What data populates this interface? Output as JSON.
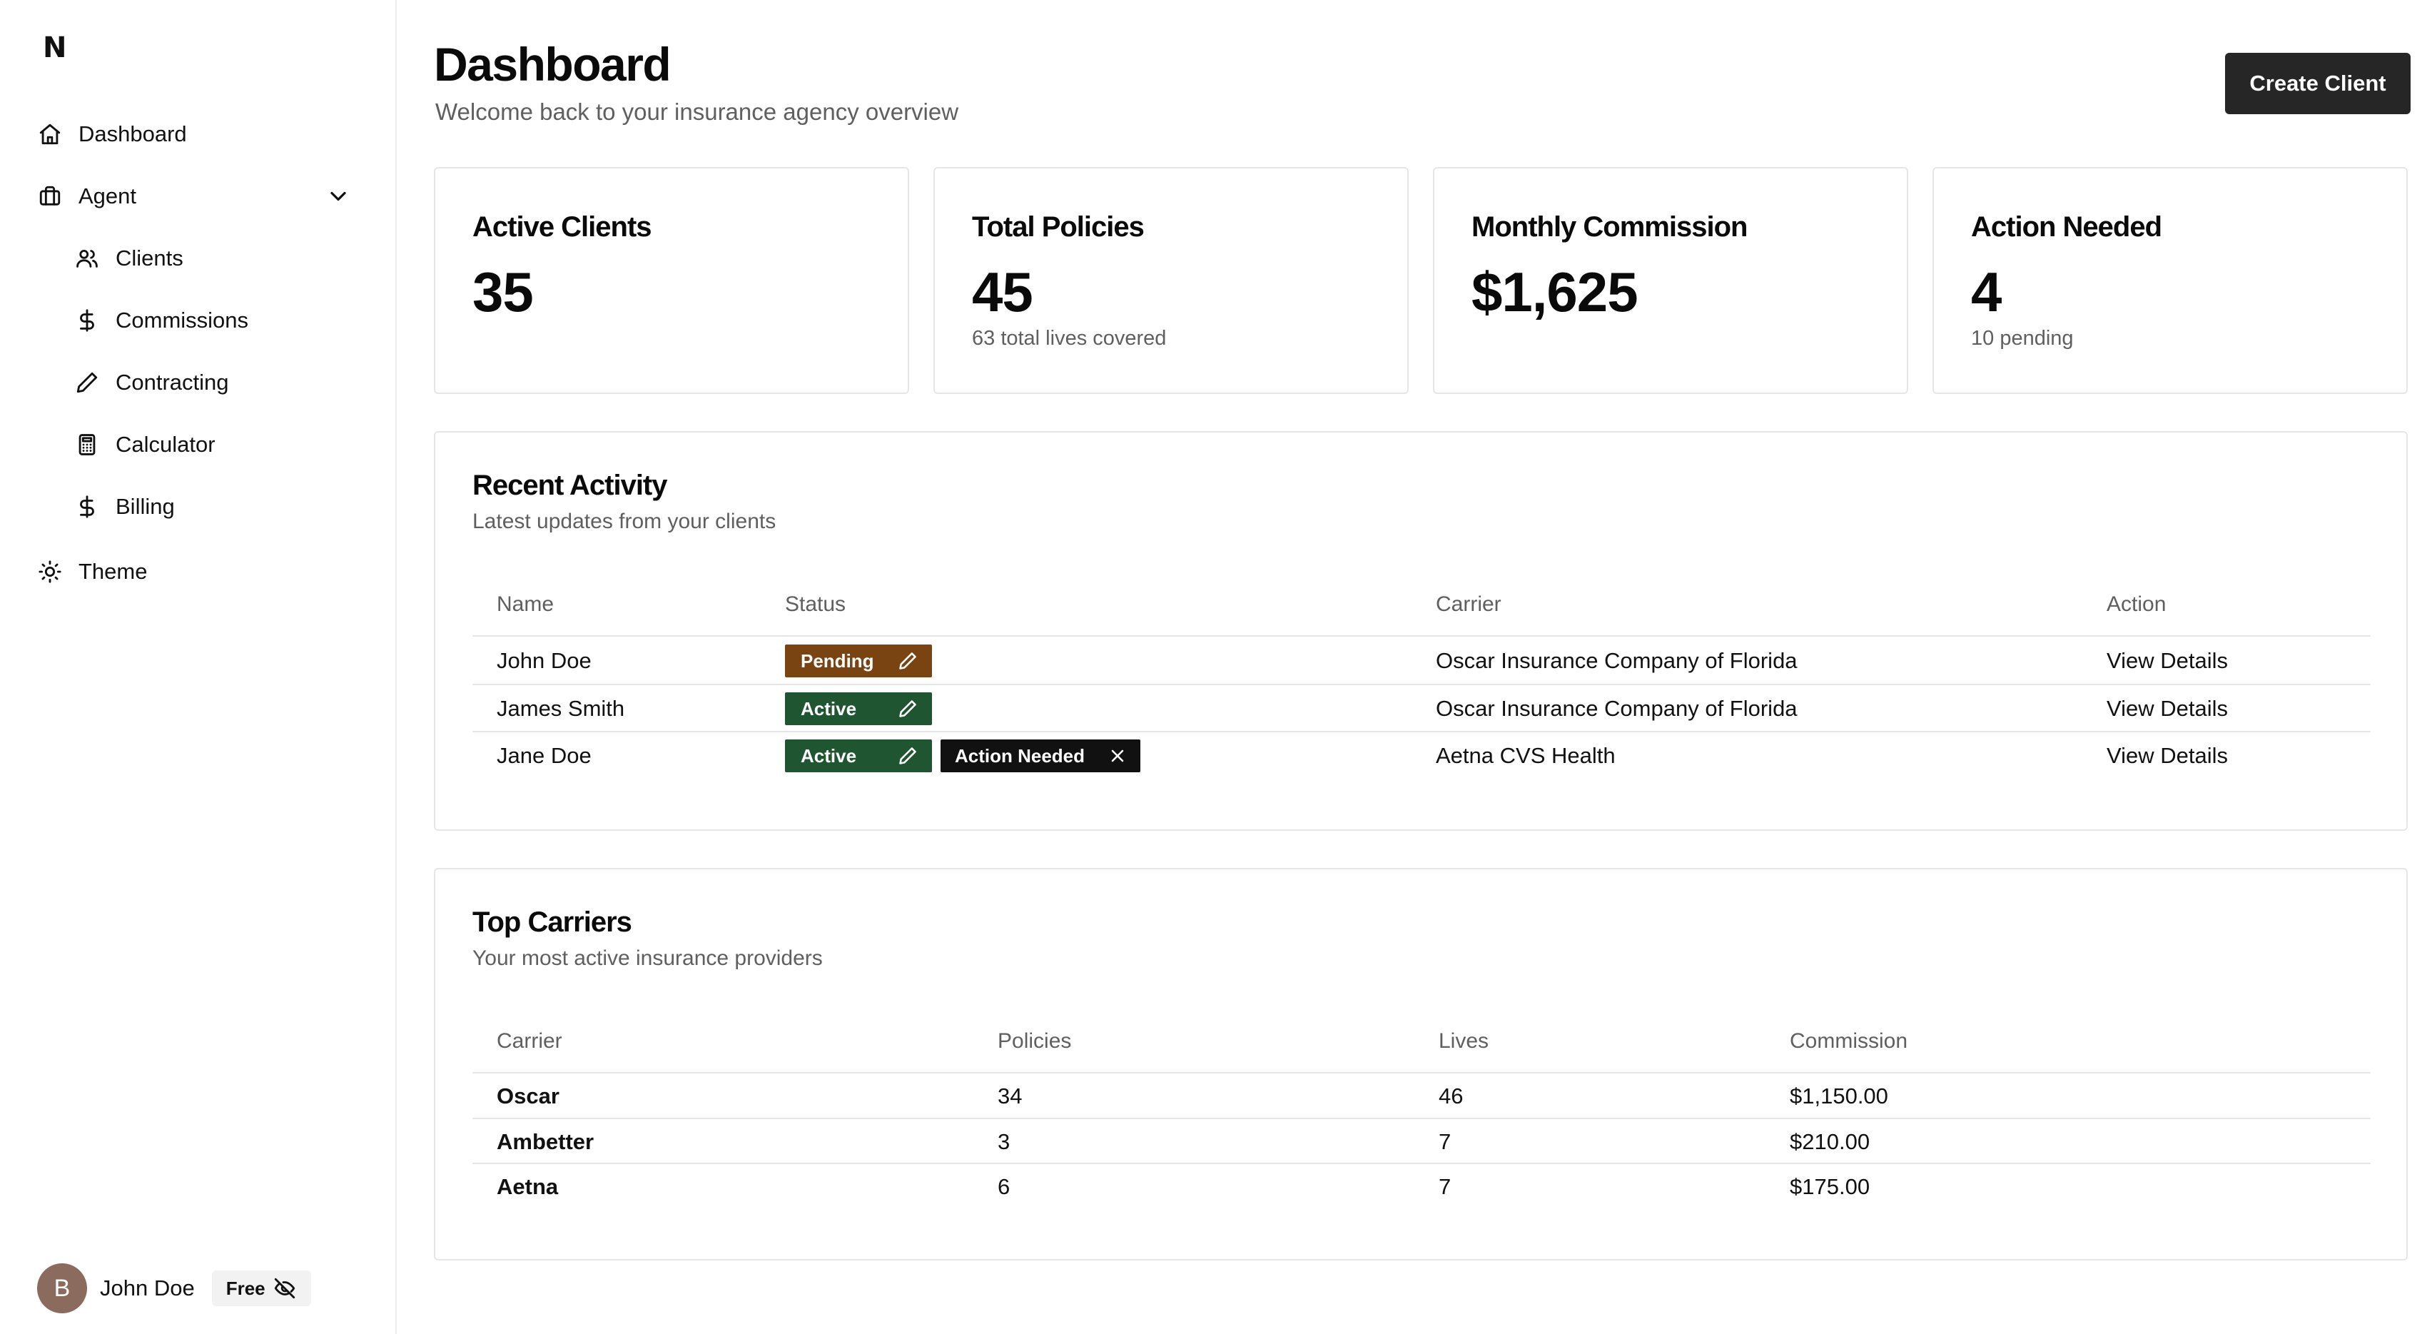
{
  "app": {
    "logo": "N"
  },
  "sidebar": {
    "items": [
      {
        "label": "Dashboard",
        "icon": "home-icon"
      },
      {
        "label": "Agent",
        "icon": "briefcase-icon"
      },
      {
        "label": "Clients",
        "icon": "users-icon"
      },
      {
        "label": "Commissions",
        "icon": "dollar-icon"
      },
      {
        "label": "Contracting",
        "icon": "pencil-icon"
      },
      {
        "label": "Calculator",
        "icon": "calculator-icon"
      },
      {
        "label": "Billing",
        "icon": "dollar-icon"
      },
      {
        "label": "Theme",
        "icon": "sun-icon"
      }
    ],
    "user": {
      "avatar_initial": "B",
      "name": "John Doe",
      "plan": "Free"
    }
  },
  "header": {
    "title": "Dashboard",
    "subtitle": "Welcome back to your insurance agency overview",
    "create_label": "Create Client"
  },
  "stats": [
    {
      "title": "Active Clients",
      "value": "35",
      "sub": ""
    },
    {
      "title": "Total Policies",
      "value": "45",
      "sub": "63 total lives covered"
    },
    {
      "title": "Monthly Commission",
      "value": "$1,625",
      "sub": ""
    },
    {
      "title": "Action Needed",
      "value": "4",
      "sub": "10 pending"
    }
  ],
  "recent_activity": {
    "title": "Recent Activity",
    "subtitle": "Latest updates from your clients",
    "columns": [
      "Name",
      "Status",
      "Carrier",
      "Action"
    ],
    "rows": [
      {
        "name": "John Doe",
        "status": "Pending",
        "extra_badge": "",
        "carrier": "Oscar Insurance Company of Florida",
        "action": "View Details"
      },
      {
        "name": "James Smith",
        "status": "Active",
        "extra_badge": "",
        "carrier": "Oscar Insurance Company of Florida",
        "action": "View Details"
      },
      {
        "name": "Jane Doe",
        "status": "Active",
        "extra_badge": "Action Needed",
        "carrier": "Aetna CVS Health",
        "action": "View Details"
      }
    ]
  },
  "top_carriers": {
    "title": "Top Carriers",
    "subtitle": "Your most active insurance providers",
    "columns": [
      "Carrier",
      "Policies",
      "Lives",
      "Commission"
    ],
    "rows": [
      {
        "carrier": "Oscar",
        "policies": "34",
        "lives": "46",
        "commission": "$1,150.00"
      },
      {
        "carrier": "Ambetter",
        "policies": "3",
        "lives": "7",
        "commission": "$210.00"
      },
      {
        "carrier": "Aetna",
        "policies": "6",
        "lives": "7",
        "commission": "$175.00"
      }
    ]
  },
  "colors": {
    "pending": "#7a4412",
    "active": "#1f5631",
    "action_needed": "#111111",
    "primary_button": "#262626"
  }
}
